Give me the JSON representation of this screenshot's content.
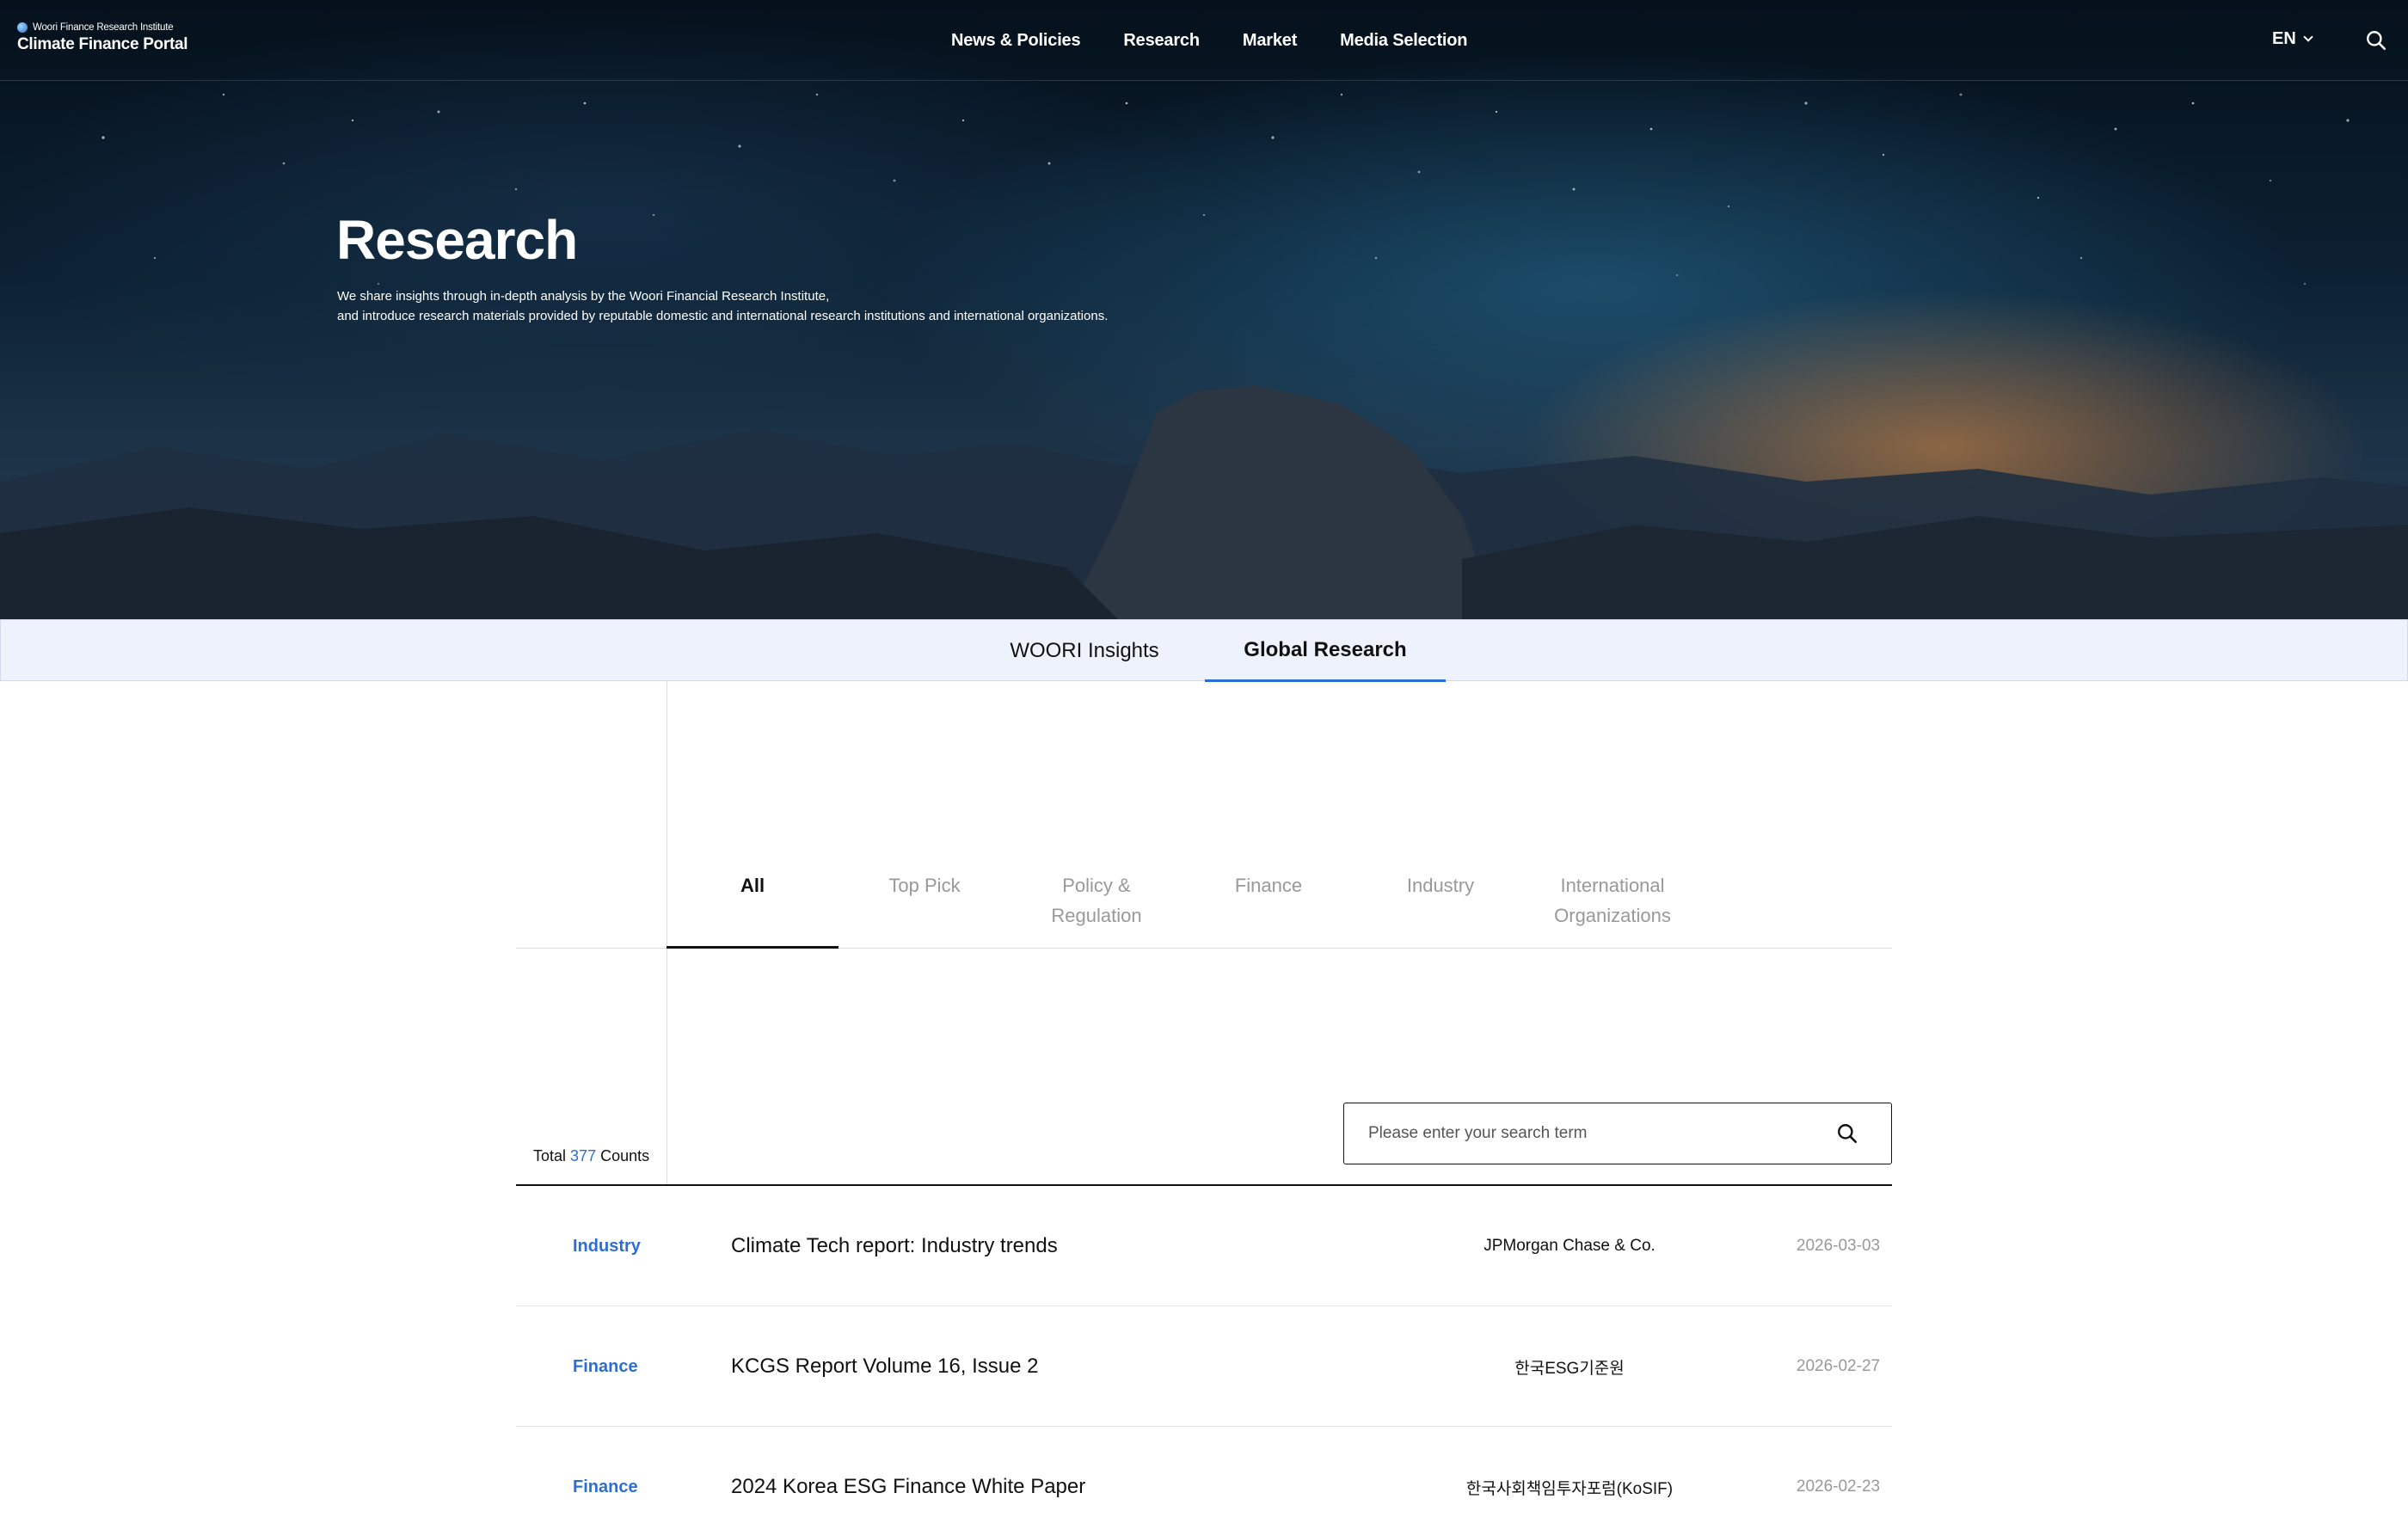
{
  "logo": {
    "org": "Woori Finance Research Institute",
    "name": "Climate Finance Portal"
  },
  "nav": {
    "items": [
      {
        "label": "News & Policies"
      },
      {
        "label": "Research"
      },
      {
        "label": "Market"
      },
      {
        "label": "Media Selection"
      }
    ],
    "language": "EN"
  },
  "hero": {
    "title": "Research",
    "description": [
      "We share insights through in-depth analysis by the Woori Financial Research Institute,",
      "and introduce research materials provided by reputable domestic and international research institutions and international organizations."
    ]
  },
  "main_tabs": [
    {
      "label": "WOORI Insights",
      "active": false
    },
    {
      "label": "Global Research",
      "active": true
    }
  ],
  "category_tabs": [
    {
      "label": "All",
      "active": true
    },
    {
      "label": "Top Pick",
      "active": false
    },
    {
      "label": "Policy & Regulation",
      "active": false
    },
    {
      "label": "Finance",
      "active": false
    },
    {
      "label": "Industry",
      "active": false
    },
    {
      "label": "International Organizations",
      "active": false
    }
  ],
  "total": {
    "prefix": "Total",
    "count": "377",
    "suffix": "Counts"
  },
  "search": {
    "placeholder": "Please enter your search term",
    "value": ""
  },
  "list": [
    {
      "category": "Industry",
      "title": "Climate Tech report: Industry trends",
      "source": "JPMorgan Chase & Co.",
      "date": "2026-03-03"
    },
    {
      "category": "Finance",
      "title": "KCGS Report Volume 16, Issue 2",
      "source": "한국ESG기준원",
      "date": "2026-02-27"
    },
    {
      "category": "Finance",
      "title": "2024 Korea ESG Finance White Paper",
      "source": "한국사회책임투자포럼(KoSIF)",
      "date": "2026-02-23"
    }
  ],
  "colors": {
    "accent": "#2b6fd3",
    "tabbar_bg": "#eef2fc",
    "muted_text": "#999999"
  }
}
